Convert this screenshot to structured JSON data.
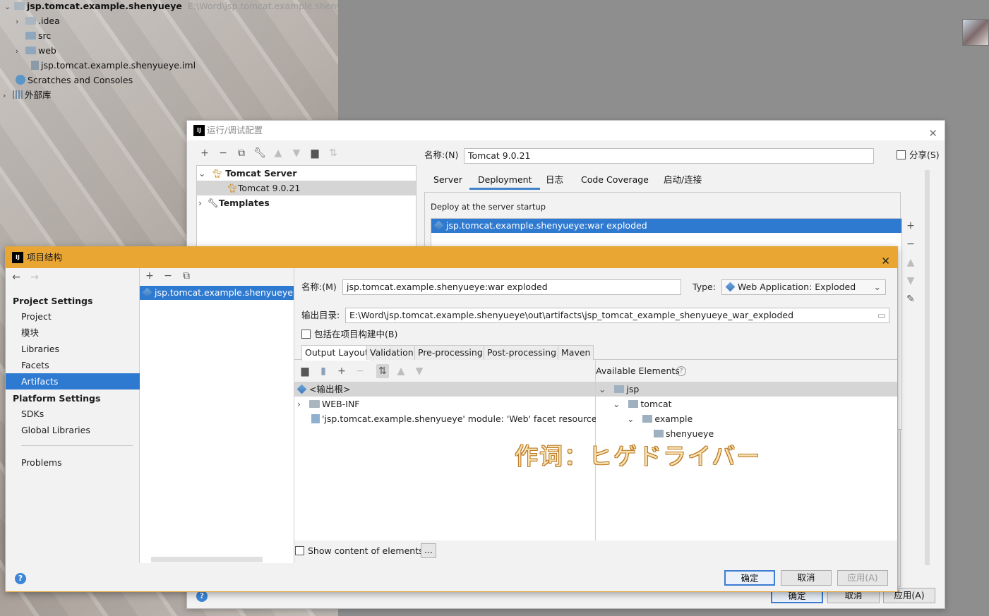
{
  "ide": {
    "project_name": "jsp.tomcat.example.shenyueye",
    "project_path": "E:\\Word\\jsp.tomcat.example.shenyueye",
    "tree": [
      ".idea",
      "src",
      "web",
      "jsp.tomcat.example.shenyueye.iml",
      "Scratches and Consoles",
      "外部库"
    ]
  },
  "run_debug": {
    "title": "运行/调试配置",
    "tree": {
      "group": "Tomcat Server",
      "config": "Tomcat 9.0.21",
      "templates": "Templates"
    },
    "name_label": "名称:(N)",
    "name_value": "Tomcat 9.0.21",
    "share_label": "分享(S)",
    "tabs": [
      "Server",
      "Deployment",
      "日志",
      "Code Coverage",
      "启动/连接"
    ],
    "active_tab": "Deployment",
    "deploy_heading": "Deploy at the server startup",
    "deploy_item": "jsp.tomcat.example.shenyueye:war exploded",
    "buttons": {
      "ok": "确定",
      "cancel": "取消",
      "apply": "应用(A)"
    }
  },
  "project_structure": {
    "title": "项目结构",
    "nav": {
      "project_settings": "Project Settings",
      "items1": [
        "Project",
        "模块",
        "Libraries",
        "Facets",
        "Artifacts"
      ],
      "platform_settings": "Platform Settings",
      "items2": [
        "SDKs",
        "Global Libraries"
      ],
      "problems": "Problems",
      "selected": "Artifacts"
    },
    "artifact_list_item": "jsp.tomcat.example.shenyueye:war",
    "name_label": "名称:(M)",
    "name_value": "jsp.tomcat.example.shenyueye:war exploded",
    "type_label": "Type:",
    "type_value": "Web Application: Exploded",
    "output_label": "输出目录:",
    "output_value": "E:\\Word\\jsp.tomcat.example.shenyueye\\out\\artifacts\\jsp_tomcat_example_shenyueye_war_exploded",
    "include_label": "包括在项目构建中(B)",
    "subtabs": [
      "Output Layout",
      "Validation",
      "Pre-processing",
      "Post-processing",
      "Maven"
    ],
    "output_root": "<输出根>",
    "layout_rows": [
      "WEB-INF",
      "'jsp.tomcat.example.shenyueye' module: 'Web' facet resources"
    ],
    "available_label": "Available Elements",
    "available_tree": [
      "jsp",
      "tomcat",
      "example",
      "shenyueye"
    ],
    "show_content_label": "Show content of elements",
    "ellipsis": "...",
    "buttons": {
      "ok": "确定",
      "cancel": "取消",
      "apply": "应用(A)"
    }
  },
  "watermark": "作词：ヒゲドライバー",
  "colors": {
    "selection": "#2f7ad1",
    "ps_title": "#e9a633",
    "accent_tab": "#4083c9"
  }
}
